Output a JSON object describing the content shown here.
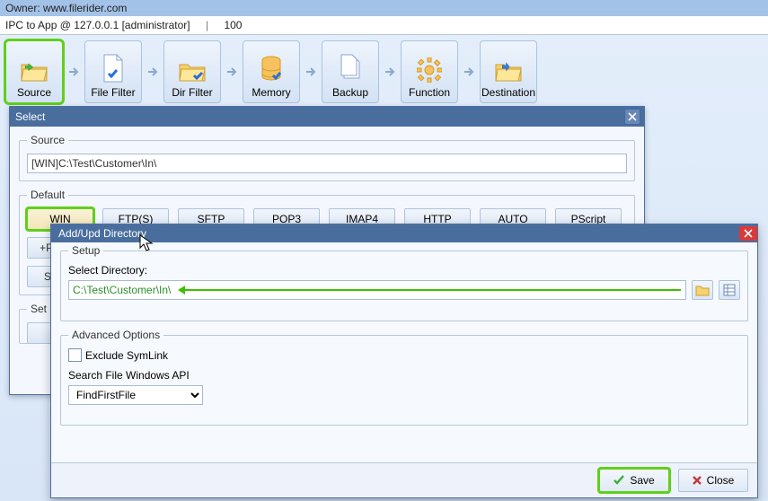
{
  "header": {
    "owner_label": "Owner:",
    "owner_value": "www.filerider.com"
  },
  "status": {
    "app": "IPC to App @ 127.0.0.1 [administrator]",
    "count": "100"
  },
  "toolbar": {
    "items": [
      {
        "label": "Source"
      },
      {
        "label": "File Filter"
      },
      {
        "label": "Dir Filter"
      },
      {
        "label": "Memory"
      },
      {
        "label": "Backup"
      },
      {
        "label": "Function"
      },
      {
        "label": "Destination"
      }
    ]
  },
  "select_dialog": {
    "title": "Select",
    "source_legend": "Source",
    "source_value": "[WIN]C:\\Test\\Customer\\In\\",
    "default_legend": "Default",
    "tabs": [
      "WIN",
      "FTP(S)",
      "SFTP",
      "POP3",
      "IMAP4",
      "HTTP",
      "AUTO",
      "PScript"
    ],
    "plus_label": "+Pl",
    "s_label": "S",
    "settings_label": "Set"
  },
  "addupd_dialog": {
    "title": "Add/Upd Directory",
    "setup_legend": "Setup",
    "select_dir_label": "Select Directory:",
    "path_value": "C:\\Test\\Customer\\In\\",
    "adv_legend": "Advanced  Options",
    "exclude_symlink_label": "Exclude SymLink",
    "search_api_label": "Search File Windows API",
    "search_api_value": "FindFirstFile",
    "save_label": "Save",
    "close_label": "Close"
  }
}
